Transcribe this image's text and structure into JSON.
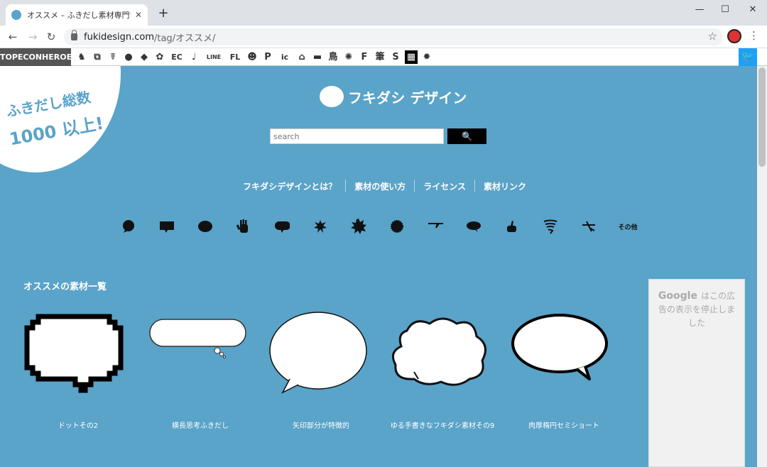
{
  "browser": {
    "tab_title": "オススメ – ふきだし素材専門サ",
    "tab_close": "✕",
    "new_tab": "+",
    "url_host": "fukidesign.com",
    "url_path": "/tag/オススメ/",
    "window_controls": {
      "minimize": "—",
      "maximize": "☐",
      "close": "✕"
    },
    "nav": {
      "back": "←",
      "forward": "→",
      "reload": "↻"
    },
    "star": "☆",
    "menu": "⋮"
  },
  "iconbar": {
    "brand": "TOPECONHEROES",
    "items": [
      {
        "name": "animal-icon",
        "glyph": "♞"
      },
      {
        "name": "copy-icon",
        "glyph": "⧉"
      },
      {
        "name": "person-icon",
        "glyph": "☤"
      },
      {
        "name": "chat-icon",
        "glyph": "●"
      },
      {
        "name": "tag-icon",
        "glyph": "◆"
      },
      {
        "name": "flower-icon",
        "glyph": "✿"
      },
      {
        "name": "ec-icon",
        "glyph": "EC"
      },
      {
        "name": "music-icon",
        "glyph": "♩"
      },
      {
        "name": "line-icon",
        "glyph": "LINE"
      },
      {
        "name": "flat-icon",
        "glyph": "FL"
      },
      {
        "name": "smile-icon",
        "glyph": "☻"
      },
      {
        "name": "parking-icon",
        "glyph": "P"
      },
      {
        "name": "icon-on-icon",
        "glyph": "ic"
      },
      {
        "name": "building-icon",
        "glyph": "⌂"
      },
      {
        "name": "bench-icon",
        "glyph": "▬"
      },
      {
        "name": "bird-kanji-icon",
        "glyph": "鳥"
      },
      {
        "name": "gear-icon",
        "glyph": "✺"
      },
      {
        "name": "font-icon",
        "glyph": "F"
      },
      {
        "name": "brush-kanji-icon",
        "glyph": "筆"
      },
      {
        "name": "s-plus-icon",
        "glyph": "S"
      },
      {
        "name": "grid-icon",
        "glyph": "▦"
      },
      {
        "name": "burst-icon",
        "glyph": "✹"
      }
    ],
    "twitter": "🐦"
  },
  "page": {
    "badge_line1": "ふきだし総数",
    "badge_line2": "1000 以上!",
    "logo_text": "フキダシ デザイン",
    "search_placeholder": "search",
    "search_button": "🔍",
    "nav_links": [
      "フキダシデザインとは？",
      "素材の使い方",
      "ライセンス",
      "素材リンク"
    ],
    "other_label": "その他",
    "section_title": "オススメの素材一覧",
    "cards": [
      {
        "caption": "ドットその2"
      },
      {
        "caption": "横長思考ふきだし"
      },
      {
        "caption": "矢印部分が特徴的"
      },
      {
        "caption": "ゆる手書きなフキダシ素材その9"
      },
      {
        "caption": "肉厚楕円セミショート"
      }
    ],
    "ad_google": "Google",
    "ad_text": "はこの広告の表示を停止しました"
  },
  "colors": {
    "page_bg": "#5aa3c9",
    "twitter": "#1da1f2"
  }
}
